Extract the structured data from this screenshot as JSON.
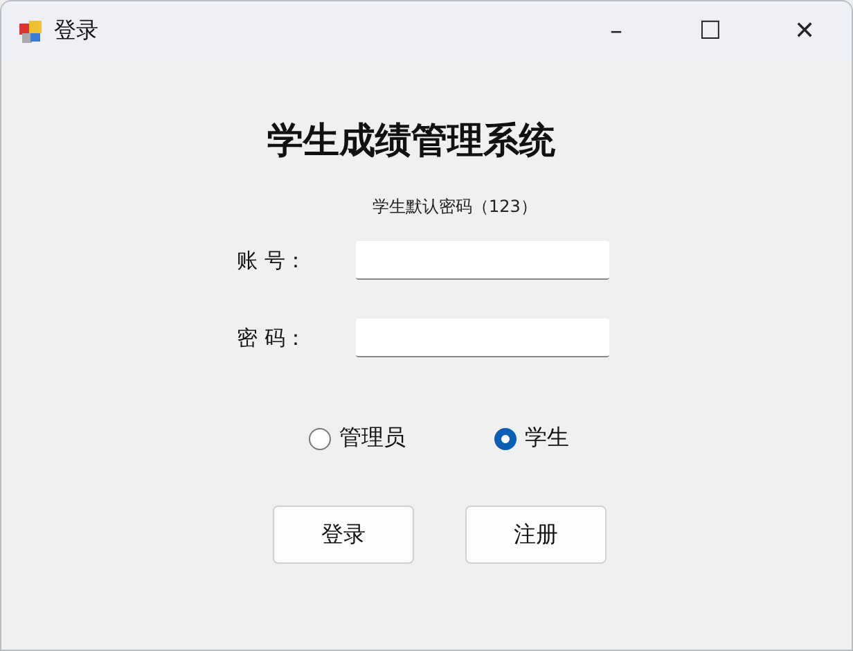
{
  "window": {
    "title": "登录",
    "controls": [
      "–",
      "☐",
      "✕"
    ]
  },
  "heading": "学生成绩管理系统",
  "hint": "学生默认密码（123）",
  "fields": [
    {
      "label": "账 号："
    },
    {
      "label": "密 码："
    }
  ],
  "roles": [
    {
      "label": "管理员",
      "selected": false
    },
    {
      "label": "学生",
      "selected": true
    }
  ],
  "buttons": [
    "登录",
    "注册"
  ]
}
